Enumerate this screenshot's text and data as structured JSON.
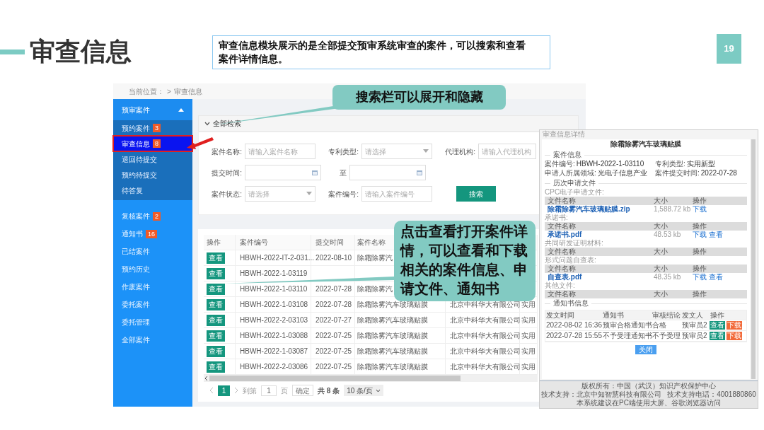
{
  "slide": {
    "title": "审查信息",
    "description": "审查信息模块展示的是全部提交预审系统审查的案件，可以搜索和查看案件详情信息。",
    "page_number": "19"
  },
  "callouts": [
    {
      "text": "搜索栏可以展开和隐藏"
    },
    {
      "text": "点击查看打开案件详情，可以查看和下载相关的案件信息、申请文件、通知书"
    }
  ],
  "app": {
    "breadcrumb": {
      "label": "当前位置：",
      "separator": ">",
      "current": "审查信息"
    },
    "sidebar": [
      {
        "label": "预审案件",
        "expanded": true,
        "selected": false,
        "annotated": false,
        "children": [
          {
            "label": "预约案件",
            "badge": "3",
            "selected": false,
            "annotated": false
          },
          {
            "label": "审查信息",
            "badge": "8",
            "selected": true,
            "annotated": true
          },
          {
            "label": "退回待提交",
            "selected": false,
            "annotated": false
          },
          {
            "label": "预约待提交",
            "selected": false,
            "annotated": false
          },
          {
            "label": "待答复",
            "selected": false,
            "annotated": false
          }
        ]
      },
      {
        "label": "复核案件",
        "badge": "2",
        "selected": false,
        "annotated": false
      },
      {
        "label": "通知书",
        "badge": "16",
        "selected": false,
        "annotated": false
      },
      {
        "label": "已结案件",
        "selected": false,
        "annotated": false
      },
      {
        "label": "预约历史",
        "selected": false,
        "annotated": false
      },
      {
        "label": "作废案件",
        "selected": false,
        "annotated": false
      },
      {
        "label": "委托案件",
        "selected": false,
        "annotated": false
      },
      {
        "label": "委托管理",
        "selected": false,
        "annotated": false
      },
      {
        "label": "全部案件",
        "selected": false,
        "annotated": false
      }
    ],
    "search": {
      "label": "全部检索",
      "expanded": true,
      "rows": [
        [
          {
            "kind": "text",
            "label": "案件名称:",
            "placeholder": "请输入案件名称"
          },
          {
            "kind": "select",
            "label": "专利类型:",
            "placeholder": "请选择"
          },
          {
            "kind": "text",
            "label": "代理机构:",
            "placeholder": "请输入代理机构"
          }
        ],
        [
          {
            "kind": "date",
            "label": "提交时间:"
          },
          {
            "kind": "date",
            "label": "至"
          }
        ],
        [
          {
            "kind": "select",
            "label": "案件状态:",
            "placeholder": "请选择"
          },
          {
            "kind": "text",
            "label": "案件编号:",
            "placeholder": "请输入案件编号"
          },
          {
            "kind": "button",
            "label": "搜索"
          }
        ]
      ]
    },
    "table": {
      "columns": [
        "操作",
        "案件编号",
        "提交时间",
        "案件名称"
      ],
      "rows": [
        {
          "cells": [
            "查看",
            "HBWH-2022-IT-2-031...",
            "2022-08-10",
            "除霜除雾汽",
            null,
            null
          ]
        },
        {
          "cells": [
            "查看",
            "HBWH-2022-1-03119",
            null,
            null,
            null,
            null
          ]
        },
        {
          "cells": [
            "查看",
            "HBWH-2022-1-03110",
            "2022-07-28",
            "除霜除雾汽",
            null,
            null
          ]
        },
        {
          "cells": [
            "查看",
            "HBWH-2022-1-03108",
            "2022-07-28",
            "除霜除雾汽车玻璃贴膜",
            "北京中科华大有限公司",
            "实用"
          ]
        },
        {
          "cells": [
            "查看",
            "HBWH-2022-2-03103",
            "2022-07-27",
            "除霜除雾汽车玻璃贴膜",
            "北京中科华大有限公司",
            "实用"
          ]
        },
        {
          "cells": [
            "查看",
            "HBWH-2022-1-03088",
            "2022-07-25",
            "除霜除雾汽车玻璃贴膜",
            "北京中科华大有限公司",
            "实用"
          ]
        },
        {
          "cells": [
            "查看",
            "HBWH-2022-1-03087",
            "2022-07-25",
            "除霜除雾汽车玻璃贴膜",
            "北京中科华大有限公司",
            "实用"
          ]
        },
        {
          "cells": [
            "查看",
            "HBWH-2022-2-03086",
            "2022-07-25",
            "除霜除雾汽车玻璃贴膜",
            "北京中科华大有限公司",
            "实用"
          ]
        }
      ]
    },
    "pagination": {
      "pages": [
        {
          "label": "1",
          "selected": true
        }
      ],
      "goto_label": "到第",
      "goto_value": "1",
      "page_unit": "页",
      "confirm": "确定",
      "total": "共 8 条",
      "page_size": "10 条/页"
    }
  },
  "detail_panel": {
    "breadcrumb": "审查信息详情",
    "title": "除霜除雾汽车玻璃贴膜",
    "case_info": {
      "heading": "案件信息",
      "fields": [
        {
          "label": "案件编号:",
          "value": "HBWH-2022-1-03110"
        },
        {
          "label": "专利类型:",
          "value": "实用新型"
        },
        {
          "label": "申请人所属领域:",
          "value": "光电子信息产业"
        },
        {
          "label": "案件提交时间:",
          "value": "2022-07-28"
        }
      ]
    },
    "files": {
      "heading": "历次申请文件",
      "groups": [
        {
          "label": "CPC电子申请文件:",
          "columns": [
            "文件名称",
            "大小",
            "操作"
          ],
          "files": [
            {
              "name": "除霜除雾汽车玻璃贴膜.zip",
              "size": "1,588.72 kb",
              "actions": [
                "下载"
              ]
            }
          ]
        },
        {
          "label": "承诺书:",
          "columns": [
            "文件名称",
            "大小",
            "操作"
          ],
          "files": [
            {
              "name": "承诺书.pdf",
              "size": "48.53 kb",
              "actions": [
                "下载",
                "查看"
              ]
            }
          ]
        },
        {
          "label": "共同研发证明材料:",
          "columns": [
            "文件名称",
            "大小",
            "操作"
          ]
        },
        {
          "label": "形式问题自查表:",
          "columns": [
            "文件名称",
            "大小",
            "操作"
          ],
          "files": [
            {
              "name": "自查表.pdf",
              "size": "48.35 kb",
              "actions": [
                "下载",
                "查看"
              ]
            }
          ]
        },
        {
          "label": "其他文件:",
          "columns": [
            "文件名称",
            "大小",
            "操作"
          ]
        }
      ]
    },
    "notices": {
      "heading": "通知书信息",
      "columns": [
        "发文时间",
        "通知书",
        "审核结论",
        "发文人",
        "操作"
      ],
      "rows": [
        {
          "cells": [
            "2022-08-02 16:36",
            "预审合格通知书",
            "合格",
            "预审员2"
          ],
          "actions": [
            {
              "kind": "view",
              "label": "查看"
            },
            {
              "kind": "download",
              "label": "下载"
            }
          ]
        },
        {
          "cells": [
            "2022-07-28 15:55",
            "不予受理通知书",
            "不予受理",
            "预审员2"
          ],
          "actions": [
            {
              "kind": "view",
              "label": "查看"
            },
            {
              "kind": "download",
              "label": "下载"
            }
          ]
        }
      ]
    },
    "close_button": "关闭",
    "footer": [
      "版权所有：中国（武汉）知识产权保护中心",
      "技术支持：北京中知智慧科技有限公司",
      "技术支持电话：4001880860",
      "本系统建议在PC端使用大屏、谷歌浏览器访问"
    ]
  }
}
